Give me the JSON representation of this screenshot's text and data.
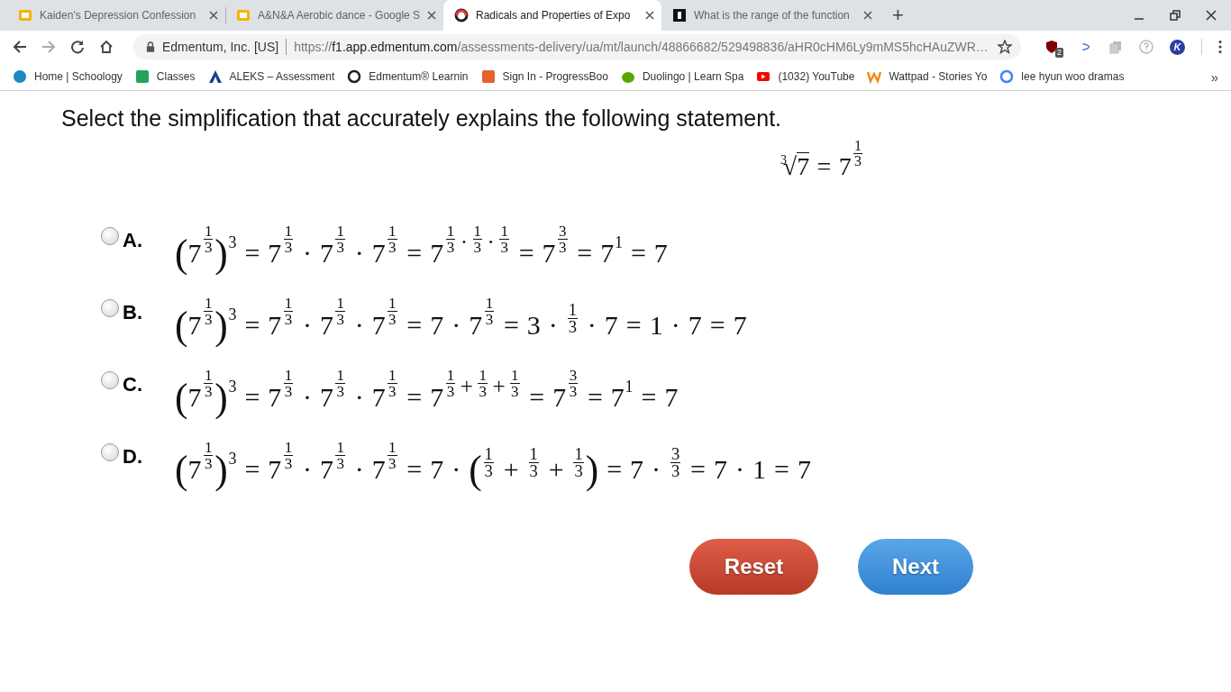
{
  "tabs": [
    {
      "title": "Kaiden’s Depression Confession",
      "selected": false
    },
    {
      "title": "A&N&A Aerobic dance - Google S",
      "selected": false
    },
    {
      "title": "Radicals and Properties of Expo",
      "selected": true
    },
    {
      "title": "What is the range of the function",
      "selected": false
    }
  ],
  "new_tab": "+",
  "address_bar": {
    "site": "Edmentum, Inc. [US]",
    "scheme": "https://",
    "host": "f1.app.edmentum.com",
    "path": "/assessments-delivery/ua/mt/launch/48866682/529498836/aHR0cHM6Ly9mMS5hcHAuZWR…"
  },
  "extensions": {
    "badge": "2",
    "avatar": "K"
  },
  "bookmarks": [
    {
      "label": "Home | Schoology"
    },
    {
      "label": "Classes"
    },
    {
      "label": "ALEKS – Assessment"
    },
    {
      "label": "Edmentum® Learnin"
    },
    {
      "label": "Sign In - ProgressBoo"
    },
    {
      "label": "Duolingo | Learn Spa"
    },
    {
      "label": "(1032) YouTube"
    },
    {
      "label": "Wattpad - Stories Yo"
    },
    {
      "label": "lee hyun woo dramas"
    }
  ],
  "bookmarks_overflow": "»",
  "question": {
    "prompt": "Select the simplification that accurately explains the following statement.",
    "statement": [
      {
        "kind": "root",
        "index": "3",
        "sign": "√",
        "items": [
          {
            "kind": "text",
            "text": "7"
          }
        ]
      },
      {
        "kind": "operator",
        "text": "="
      },
      {
        "kind": "power",
        "base": [
          {
            "kind": "text",
            "text": "7"
          }
        ],
        "exponent": [
          {
            "kind": "fraction",
            "numerator": "1",
            "denominator": "3"
          }
        ]
      }
    ],
    "options": [
      {
        "letter": "A.",
        "selected": false,
        "expr": [
          {
            "kind": "power",
            "base": [
              {
                "kind": "group",
                "open": "(",
                "close": ")",
                "items": [
                  {
                    "kind": "power",
                    "base": [
                      {
                        "kind": "text",
                        "text": "7"
                      }
                    ],
                    "exponent": [
                      {
                        "kind": "fraction",
                        "numerator": "1",
                        "denominator": "3"
                      }
                    ]
                  }
                ]
              }
            ],
            "exponent": [
              {
                "kind": "text",
                "text": "3"
              }
            ]
          },
          {
            "kind": "operator",
            "text": "="
          },
          {
            "kind": "power",
            "base": [
              {
                "kind": "text",
                "text": "7"
              }
            ],
            "exponent": [
              {
                "kind": "fraction",
                "numerator": "1",
                "denominator": "3"
              }
            ]
          },
          {
            "kind": "operator",
            "text": "·"
          },
          {
            "kind": "power",
            "base": [
              {
                "kind": "text",
                "text": "7"
              }
            ],
            "exponent": [
              {
                "kind": "fraction",
                "numerator": "1",
                "denominator": "3"
              }
            ]
          },
          {
            "kind": "operator",
            "text": "·"
          },
          {
            "kind": "power",
            "base": [
              {
                "kind": "text",
                "text": "7"
              }
            ],
            "exponent": [
              {
                "kind": "fraction",
                "numerator": "1",
                "denominator": "3"
              }
            ]
          },
          {
            "kind": "operator",
            "text": "="
          },
          {
            "kind": "power",
            "base": [
              {
                "kind": "text",
                "text": "7"
              }
            ],
            "exponent": [
              {
                "kind": "fraction",
                "numerator": "1",
                "denominator": "3"
              },
              {
                "kind": "operator",
                "text": "·"
              },
              {
                "kind": "fraction",
                "numerator": "1",
                "denominator": "3"
              },
              {
                "kind": "operator",
                "text": "·"
              },
              {
                "kind": "fraction",
                "numerator": "1",
                "denominator": "3"
              }
            ]
          },
          {
            "kind": "operator",
            "text": "="
          },
          {
            "kind": "power",
            "base": [
              {
                "kind": "text",
                "text": "7"
              }
            ],
            "exponent": [
              {
                "kind": "fraction",
                "numerator": "3",
                "denominator": "3"
              }
            ]
          },
          {
            "kind": "operator",
            "text": "="
          },
          {
            "kind": "power",
            "base": [
              {
                "kind": "text",
                "text": "7"
              }
            ],
            "exponent": [
              {
                "kind": "text",
                "text": "1"
              }
            ]
          },
          {
            "kind": "operator",
            "text": "="
          },
          {
            "kind": "text",
            "text": "7"
          }
        ]
      },
      {
        "letter": "B.",
        "selected": false,
        "expr": [
          {
            "kind": "power",
            "base": [
              {
                "kind": "group",
                "open": "(",
                "close": ")",
                "items": [
                  {
                    "kind": "power",
                    "base": [
                      {
                        "kind": "text",
                        "text": "7"
                      }
                    ],
                    "exponent": [
                      {
                        "kind": "fraction",
                        "numerator": "1",
                        "denominator": "3"
                      }
                    ]
                  }
                ]
              }
            ],
            "exponent": [
              {
                "kind": "text",
                "text": "3"
              }
            ]
          },
          {
            "kind": "operator",
            "text": "="
          },
          {
            "kind": "power",
            "base": [
              {
                "kind": "text",
                "text": "7"
              }
            ],
            "exponent": [
              {
                "kind": "fraction",
                "numerator": "1",
                "denominator": "3"
              }
            ]
          },
          {
            "kind": "operator",
            "text": "·"
          },
          {
            "kind": "power",
            "base": [
              {
                "kind": "text",
                "text": "7"
              }
            ],
            "exponent": [
              {
                "kind": "fraction",
                "numerator": "1",
                "denominator": "3"
              }
            ]
          },
          {
            "kind": "operator",
            "text": "·"
          },
          {
            "kind": "power",
            "base": [
              {
                "kind": "text",
                "text": "7"
              }
            ],
            "exponent": [
              {
                "kind": "fraction",
                "numerator": "1",
                "denominator": "3"
              }
            ]
          },
          {
            "kind": "operator",
            "text": "="
          },
          {
            "kind": "text",
            "text": "7"
          },
          {
            "kind": "operator",
            "text": "·"
          },
          {
            "kind": "power",
            "base": [
              {
                "kind": "text",
                "text": "7"
              }
            ],
            "exponent": [
              {
                "kind": "fraction",
                "numerator": "1",
                "denominator": "3"
              }
            ]
          },
          {
            "kind": "operator",
            "text": "="
          },
          {
            "kind": "text",
            "text": "3"
          },
          {
            "kind": "operator",
            "text": "·"
          },
          {
            "kind": "fraction",
            "numerator": "1",
            "denominator": "3"
          },
          {
            "kind": "operator",
            "text": "·"
          },
          {
            "kind": "text",
            "text": "7"
          },
          {
            "kind": "operator",
            "text": "="
          },
          {
            "kind": "text",
            "text": "1"
          },
          {
            "kind": "operator",
            "text": "·"
          },
          {
            "kind": "text",
            "text": "7"
          },
          {
            "kind": "operator",
            "text": "="
          },
          {
            "kind": "text",
            "text": "7"
          }
        ]
      },
      {
        "letter": "C.",
        "selected": false,
        "expr": [
          {
            "kind": "power",
            "base": [
              {
                "kind": "group",
                "open": "(",
                "close": ")",
                "items": [
                  {
                    "kind": "power",
                    "base": [
                      {
                        "kind": "text",
                        "text": "7"
                      }
                    ],
                    "exponent": [
                      {
                        "kind": "fraction",
                        "numerator": "1",
                        "denominator": "3"
                      }
                    ]
                  }
                ]
              }
            ],
            "exponent": [
              {
                "kind": "text",
                "text": "3"
              }
            ]
          },
          {
            "kind": "operator",
            "text": "="
          },
          {
            "kind": "power",
            "base": [
              {
                "kind": "text",
                "text": "7"
              }
            ],
            "exponent": [
              {
                "kind": "fraction",
                "numerator": "1",
                "denominator": "3"
              }
            ]
          },
          {
            "kind": "operator",
            "text": "·"
          },
          {
            "kind": "power",
            "base": [
              {
                "kind": "text",
                "text": "7"
              }
            ],
            "exponent": [
              {
                "kind": "fraction",
                "numerator": "1",
                "denominator": "3"
              }
            ]
          },
          {
            "kind": "operator",
            "text": "·"
          },
          {
            "kind": "power",
            "base": [
              {
                "kind": "text",
                "text": "7"
              }
            ],
            "exponent": [
              {
                "kind": "fraction",
                "numerator": "1",
                "denominator": "3"
              }
            ]
          },
          {
            "kind": "operator",
            "text": "="
          },
          {
            "kind": "power",
            "base": [
              {
                "kind": "text",
                "text": "7"
              }
            ],
            "exponent": [
              {
                "kind": "fraction",
                "numerator": "1",
                "denominator": "3"
              },
              {
                "kind": "operator",
                "text": "+"
              },
              {
                "kind": "fraction",
                "numerator": "1",
                "denominator": "3"
              },
              {
                "kind": "operator",
                "text": "+"
              },
              {
                "kind": "fraction",
                "numerator": "1",
                "denominator": "3"
              }
            ]
          },
          {
            "kind": "operator",
            "text": "="
          },
          {
            "kind": "power",
            "base": [
              {
                "kind": "text",
                "text": "7"
              }
            ],
            "exponent": [
              {
                "kind": "fraction",
                "numerator": "3",
                "denominator": "3"
              }
            ]
          },
          {
            "kind": "operator",
            "text": "="
          },
          {
            "kind": "power",
            "base": [
              {
                "kind": "text",
                "text": "7"
              }
            ],
            "exponent": [
              {
                "kind": "text",
                "text": "1"
              }
            ]
          },
          {
            "kind": "operator",
            "text": "="
          },
          {
            "kind": "text",
            "text": "7"
          }
        ]
      },
      {
        "letter": "D.",
        "selected": false,
        "expr": [
          {
            "kind": "power",
            "base": [
              {
                "kind": "group",
                "open": "(",
                "close": ")",
                "items": [
                  {
                    "kind": "power",
                    "base": [
                      {
                        "kind": "text",
                        "text": "7"
                      }
                    ],
                    "exponent": [
                      {
                        "kind": "fraction",
                        "numerator": "1",
                        "denominator": "3"
                      }
                    ]
                  }
                ]
              }
            ],
            "exponent": [
              {
                "kind": "text",
                "text": "3"
              }
            ]
          },
          {
            "kind": "operator",
            "text": "="
          },
          {
            "kind": "power",
            "base": [
              {
                "kind": "text",
                "text": "7"
              }
            ],
            "exponent": [
              {
                "kind": "fraction",
                "numerator": "1",
                "denominator": "3"
              }
            ]
          },
          {
            "kind": "operator",
            "text": "·"
          },
          {
            "kind": "power",
            "base": [
              {
                "kind": "text",
                "text": "7"
              }
            ],
            "exponent": [
              {
                "kind": "fraction",
                "numerator": "1",
                "denominator": "3"
              }
            ]
          },
          {
            "kind": "operator",
            "text": "·"
          },
          {
            "kind": "power",
            "base": [
              {
                "kind": "text",
                "text": "7"
              }
            ],
            "exponent": [
              {
                "kind": "fraction",
                "numerator": "1",
                "denominator": "3"
              }
            ]
          },
          {
            "kind": "operator",
            "text": "="
          },
          {
            "kind": "text",
            "text": "7"
          },
          {
            "kind": "operator",
            "text": "·"
          },
          {
            "kind": "group",
            "open": "(",
            "close": ")",
            "items": [
              {
                "kind": "fraction",
                "numerator": "1",
                "denominator": "3"
              },
              {
                "kind": "operator",
                "text": "+"
              },
              {
                "kind": "fraction",
                "numerator": "1",
                "denominator": "3"
              },
              {
                "kind": "operator",
                "text": "+"
              },
              {
                "kind": "fraction",
                "numerator": "1",
                "denominator": "3"
              }
            ]
          },
          {
            "kind": "operator",
            "text": "="
          },
          {
            "kind": "text",
            "text": "7"
          },
          {
            "kind": "operator",
            "text": "·"
          },
          {
            "kind": "fraction",
            "numerator": "3",
            "denominator": "3"
          },
          {
            "kind": "operator",
            "text": "="
          },
          {
            "kind": "text",
            "text": "7"
          },
          {
            "kind": "operator",
            "text": "·"
          },
          {
            "kind": "text",
            "text": "1"
          },
          {
            "kind": "operator",
            "text": "="
          },
          {
            "kind": "text",
            "text": "7"
          }
        ]
      }
    ]
  },
  "buttons": [
    {
      "label": "Reset",
      "kind": "reset"
    },
    {
      "label": "Next",
      "kind": "next"
    }
  ]
}
